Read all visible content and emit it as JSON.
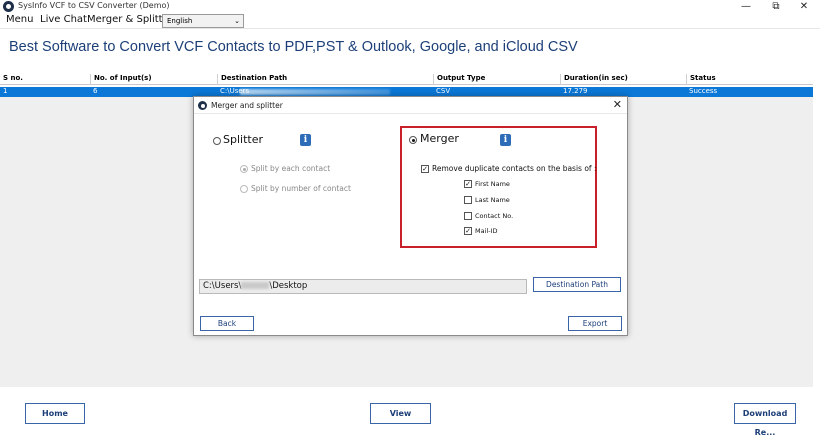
{
  "window": {
    "title": "SysInfo VCF to CSV Converter (Demo)",
    "controls": {
      "minimize": "—",
      "maximize": "⧉",
      "close": "✕"
    }
  },
  "menubar": {
    "items": [
      "Menu",
      "Live Chat",
      "Merger & Splitter"
    ],
    "language": "English"
  },
  "headline": "Best Software to Convert VCF Contacts to PDF,PST & Outlook, Google, and iCloud CSV",
  "table": {
    "columns": [
      "S no.",
      "No. of Input(s)",
      "Destination Path",
      "Output Type",
      "Duration(in sec)",
      "Status"
    ],
    "rows": [
      {
        "sno": "1",
        "inputs": "6",
        "path": "C:\\Users",
        "type": "CSV",
        "duration": "17.279",
        "status": "Success"
      }
    ]
  },
  "dialog": {
    "title": "Merger and splitter",
    "close": "✕",
    "splitter": {
      "label": "Splitter",
      "selected": false,
      "options": [
        "Split by each contact",
        "Split by number of contact"
      ]
    },
    "merger": {
      "label": "Merger",
      "selected": true,
      "remove_duplicates_label": "Remove duplicate contacts on the basis of :",
      "remove_duplicates_checked": true,
      "fields": [
        {
          "label": "First Name",
          "checked": true
        },
        {
          "label": "Last Name",
          "checked": false
        },
        {
          "label": "Contact No.",
          "checked": false
        },
        {
          "label": "Mail-ID",
          "checked": true
        }
      ]
    },
    "path_prefix": "C:\\Users\\",
    "path_suffix": "\\Desktop",
    "destination_button": "Destination Path",
    "back_button": "Back",
    "export_button": "Export"
  },
  "bottom_buttons": {
    "home": "Home",
    "view": "View",
    "download": "Download Re..."
  },
  "colors": {
    "accent": "#1c3f78",
    "selection": "#0b78d7",
    "highlight": "#c8202a"
  }
}
